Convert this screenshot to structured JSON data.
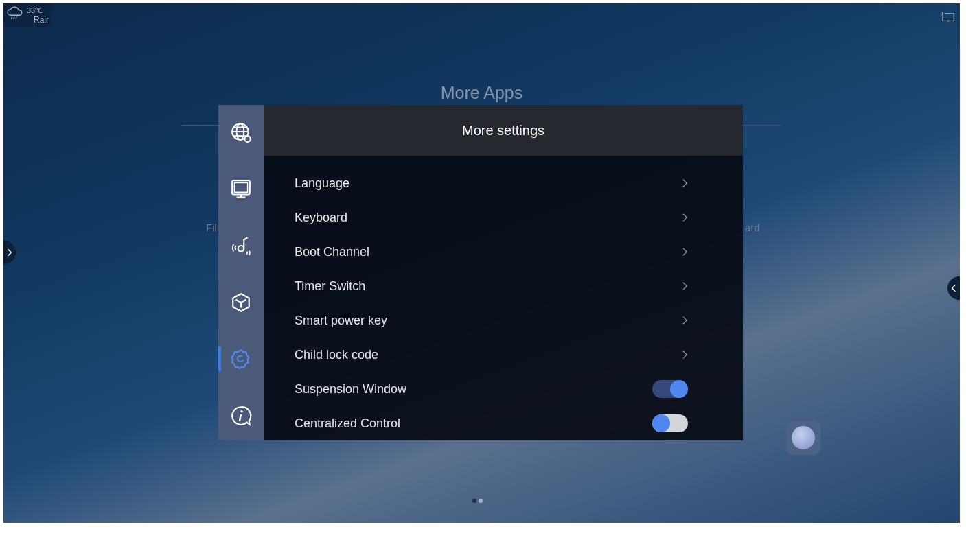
{
  "status": {
    "temperature": "33℃",
    "weather": "Rair"
  },
  "page_title": "More Apps",
  "background_app_labels": [
    "Fil",
    "ard"
  ],
  "settings_panel": {
    "title": "More settings",
    "sidebar": [
      {
        "kind": "globe",
        "selected": false
      },
      {
        "kind": "monitor",
        "selected": false
      },
      {
        "kind": "sound",
        "selected": false
      },
      {
        "kind": "cube",
        "selected": false
      },
      {
        "kind": "gear",
        "selected": true
      },
      {
        "kind": "info",
        "selected": false
      }
    ],
    "items": [
      {
        "label": "Language",
        "kind": "link"
      },
      {
        "label": "Keyboard",
        "kind": "link"
      },
      {
        "label": "Boot Channel",
        "kind": "link"
      },
      {
        "label": "Timer Switch",
        "kind": "link"
      },
      {
        "label": "Smart power key",
        "kind": "link"
      },
      {
        "label": "Child lock code",
        "kind": "link"
      },
      {
        "label": "Suspension Window",
        "kind": "toggle",
        "on": true
      },
      {
        "label": "Centralized Control",
        "kind": "toggle",
        "on": false
      }
    ]
  },
  "page_dots": [
    {
      "selected": true
    },
    {
      "selected": false
    }
  ]
}
